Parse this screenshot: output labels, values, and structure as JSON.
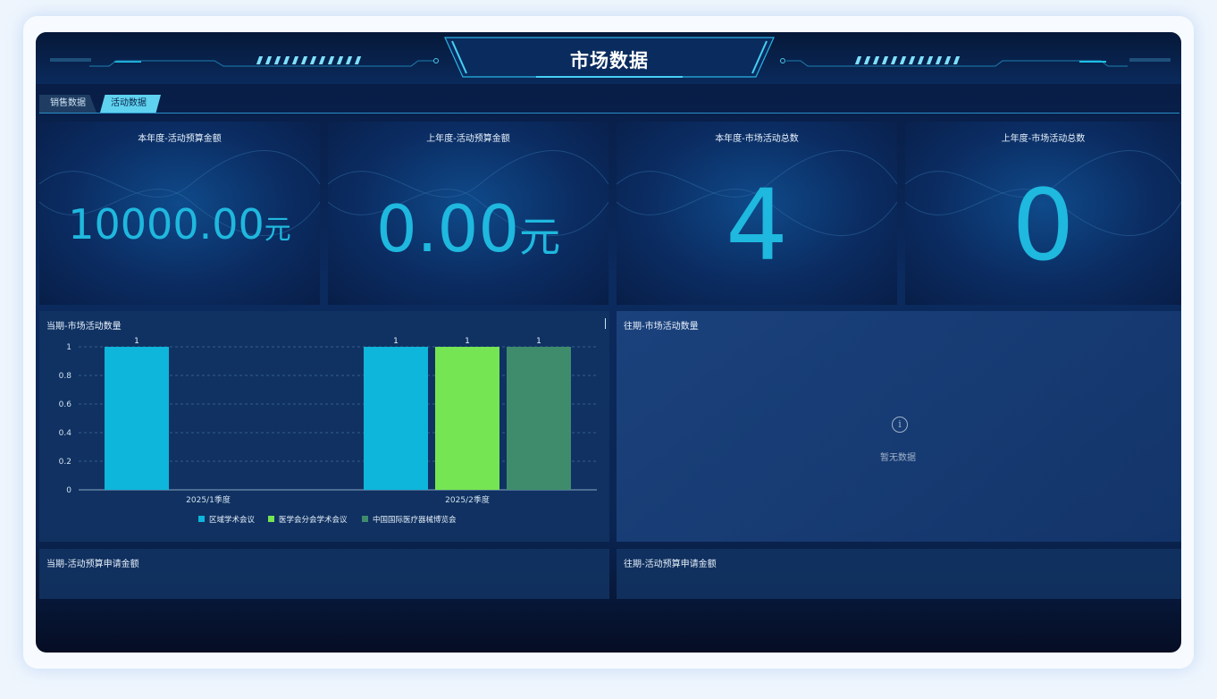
{
  "header": {
    "title": "市场数据"
  },
  "tabs": [
    {
      "label": "销售数据",
      "active": false
    },
    {
      "label": "活动数据",
      "active": true
    }
  ],
  "cards": [
    {
      "title": "本年度-活动预算金额",
      "value": "10000.00",
      "unit": "元"
    },
    {
      "title": "上年度-活动预算金额",
      "value": "0.00",
      "unit": "元"
    },
    {
      "title": "本年度-市场活动总数",
      "value": "4",
      "unit": ""
    },
    {
      "title": "上年度-市场活动总数",
      "value": "0",
      "unit": ""
    }
  ],
  "panels": {
    "current_activity": {
      "title": "当期-市场活动数量"
    },
    "past_activity": {
      "title": "往期-市场活动数量",
      "empty_text": "暂无数据"
    },
    "current_budget": {
      "title": "当期-活动预算申请金额"
    },
    "past_budget": {
      "title": "往期-活动预算申请金额"
    }
  },
  "chart_data": {
    "type": "bar",
    "categories": [
      "2025/1季度",
      "2025/2季度"
    ],
    "series": [
      {
        "name": "区域学术会议",
        "color": "#0eb6db",
        "values": [
          1,
          1
        ]
      },
      {
        "name": "医学会分会学术会议",
        "color": "#75e553",
        "values": [
          null,
          1
        ]
      },
      {
        "name": "中国国际医疗器械博览会",
        "color": "#3e8c6c",
        "values": [
          null,
          1
        ]
      }
    ],
    "yticks": [
      "0",
      "0.2",
      "0.4",
      "0.6",
      "0.8",
      "1"
    ],
    "ylim": [
      0,
      1
    ],
    "data_labels": true,
    "legend": "bottom-center",
    "grid": true
  }
}
